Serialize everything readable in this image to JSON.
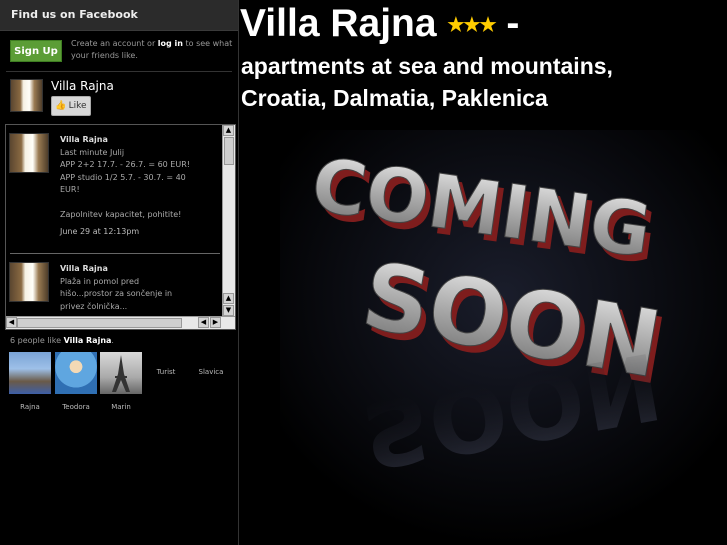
{
  "header": {
    "title": "Villa Rajna",
    "stars": "★★★",
    "dash": "-",
    "subtitle_line1": "apartments at sea and mountains,",
    "subtitle_line2": "Croatia, Dalmatia, Paklenica"
  },
  "fb": {
    "heading": "Find us on Facebook",
    "signup_label": "Sign Up",
    "signup_text_1": "Create an account or ",
    "signup_login": "log in",
    "signup_text_2": " to see what your friends like.",
    "page_name": "Villa Rajna",
    "like_label": "Like",
    "posts": [
      {
        "author": "Villa Rajna",
        "lines": [
          "Last minute Julij",
          "APP 2+2 17.7. - 26.7. = 60 EUR!",
          "APP studio 1/2 5.7. - 30.7. = 40",
          "EUR!",
          "",
          "Zapolnitev kapacitet, pohitite!"
        ],
        "time": "June 29 at 12:13pm"
      },
      {
        "author": "Villa Rajna",
        "lines": [
          "Plaža in pomol pred",
          "hišo...prostor za sončenje in",
          "privez čolnička..."
        ]
      }
    ],
    "fans_count_prefix": "6 people like ",
    "fans_count_page": "Villa Rajna",
    "fans_count_suffix": ".",
    "fans": [
      "Rajna",
      "Teodora",
      "Marin",
      "Turist",
      "Slavica"
    ]
  },
  "art": {
    "line1": "COMING",
    "line2": "SOON"
  },
  "colors": {
    "background": "#000000",
    "signup_green": "#5b9d36",
    "star_gold": "#ffcc00",
    "art_red": "#9e2a2a",
    "art_silver": "#c9c9c9"
  }
}
